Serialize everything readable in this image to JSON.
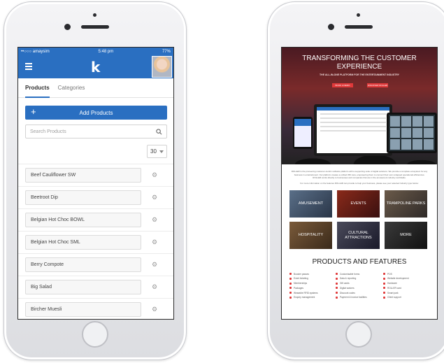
{
  "app": {
    "status": {
      "carrier": "••○○○ amaysim",
      "time": "5:48 pm",
      "battery": "77%"
    },
    "logo": "k",
    "tabs": [
      "Products",
      "Categories"
    ],
    "add_button": {
      "icon": "+",
      "label": "Add Products"
    },
    "search": {
      "placeholder": "Search Products"
    },
    "page_size": "30",
    "products": [
      "Beef Cauliflower SW",
      "Beetroot Dip",
      "Belgian Hot Choc BOWL",
      "Belgian Hot Choc SML",
      "Berry Compote",
      "Big Salad",
      "Bircher Muesli"
    ]
  },
  "website": {
    "hero_title": "TRANSFORMING THE CUSTOMER EXPERIENCE",
    "hero_subtitle": "THE ALL-IN-ONE PLATFORM FOR THE ENTERTAINMENT INDUSTRY",
    "buttons": [
      "BOOK A DEMO",
      "DISCOVER ROLLER"
    ],
    "intro_1": "ROLLER is the pioneering customer-centric software platform with a supporting suite of digital solutions. We provide a complete ecosystem for any business in entertainment. Our platform creates a unified 360 view, empowering them to connect their own untapped operational efficiencies. ROLLER works directly to businesses and companies that are in the amusement industry worldwide.",
    "intro_2": "For more information on the features ROLLER can provide to help your business, please see your selected industry type below:",
    "tiles": [
      "AMUSEMENT",
      "EVENTS",
      "TRAMPOLINE PARKS",
      "HOSPITALITY",
      "CULTURAL ATTRACTIONS",
      "MORE"
    ],
    "features_title": "PRODUCTS AND FEATURES",
    "features": [
      "Booster passes",
      "Customisable forms",
      "POS",
      "Event ticketing",
      "Data & reporting",
      "Website development",
      "Memberships",
      "Gift cards",
      "Hardware",
      "Packages",
      "Digital waivers",
      "ROLLER card",
      "Wearable RFID systems",
      "Discount codes",
      "Smart park",
      "Enquiry management",
      "Payment & invoice facilities",
      "Client support"
    ]
  }
}
